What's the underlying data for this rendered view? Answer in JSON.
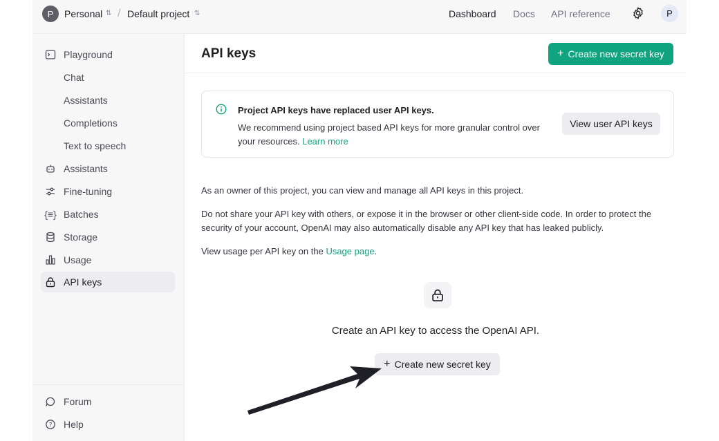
{
  "header": {
    "org_initial": "P",
    "org_name": "Personal",
    "separator": "/",
    "project_name": "Default project",
    "nav": [
      "Dashboard",
      "Docs",
      "API reference"
    ],
    "user_initial": "P"
  },
  "sidebar": {
    "items": [
      {
        "label": "Playground",
        "icon": "terminal-icon"
      },
      {
        "label": "Chat"
      },
      {
        "label": "Assistants"
      },
      {
        "label": "Completions"
      },
      {
        "label": "Text to speech"
      },
      {
        "label": "Assistants",
        "icon": "robot-icon"
      },
      {
        "label": "Fine-tuning",
        "icon": "sliders-icon"
      },
      {
        "label": "Batches",
        "icon": "braces-icon"
      },
      {
        "label": "Storage",
        "icon": "database-icon"
      },
      {
        "label": "Usage",
        "icon": "bar-chart-icon"
      },
      {
        "label": "API keys",
        "icon": "lock-icon",
        "active": true
      }
    ],
    "bottom": [
      {
        "label": "Forum",
        "icon": "chat-bubble-icon"
      },
      {
        "label": "Help",
        "icon": "help-icon"
      }
    ]
  },
  "main": {
    "title": "API keys",
    "create_button": "Create new secret key",
    "notice": {
      "heading": "Project API keys have replaced user API keys.",
      "body": "We recommend using project based API keys for more granular control over your resources.",
      "link": "Learn more",
      "button": "View user API keys"
    },
    "para1": "As an owner of this project, you can view and manage all API keys in this project.",
    "para2": "Do not share your API key with others, or expose it in the browser or other client-side code. In order to protect the security of your account, OpenAI may also automatically disable any API key that has leaked publicly.",
    "para3_prefix": "View usage per API key on the ",
    "para3_link": "Usage page",
    "para3_suffix": ".",
    "empty_state": "Create an API key to access the OpenAI API.",
    "empty_button": "Create new secret key"
  },
  "colors": {
    "accent": "#10a37f",
    "sidebar_bg": "#f7f7f8",
    "active_bg": "#ececf1"
  }
}
